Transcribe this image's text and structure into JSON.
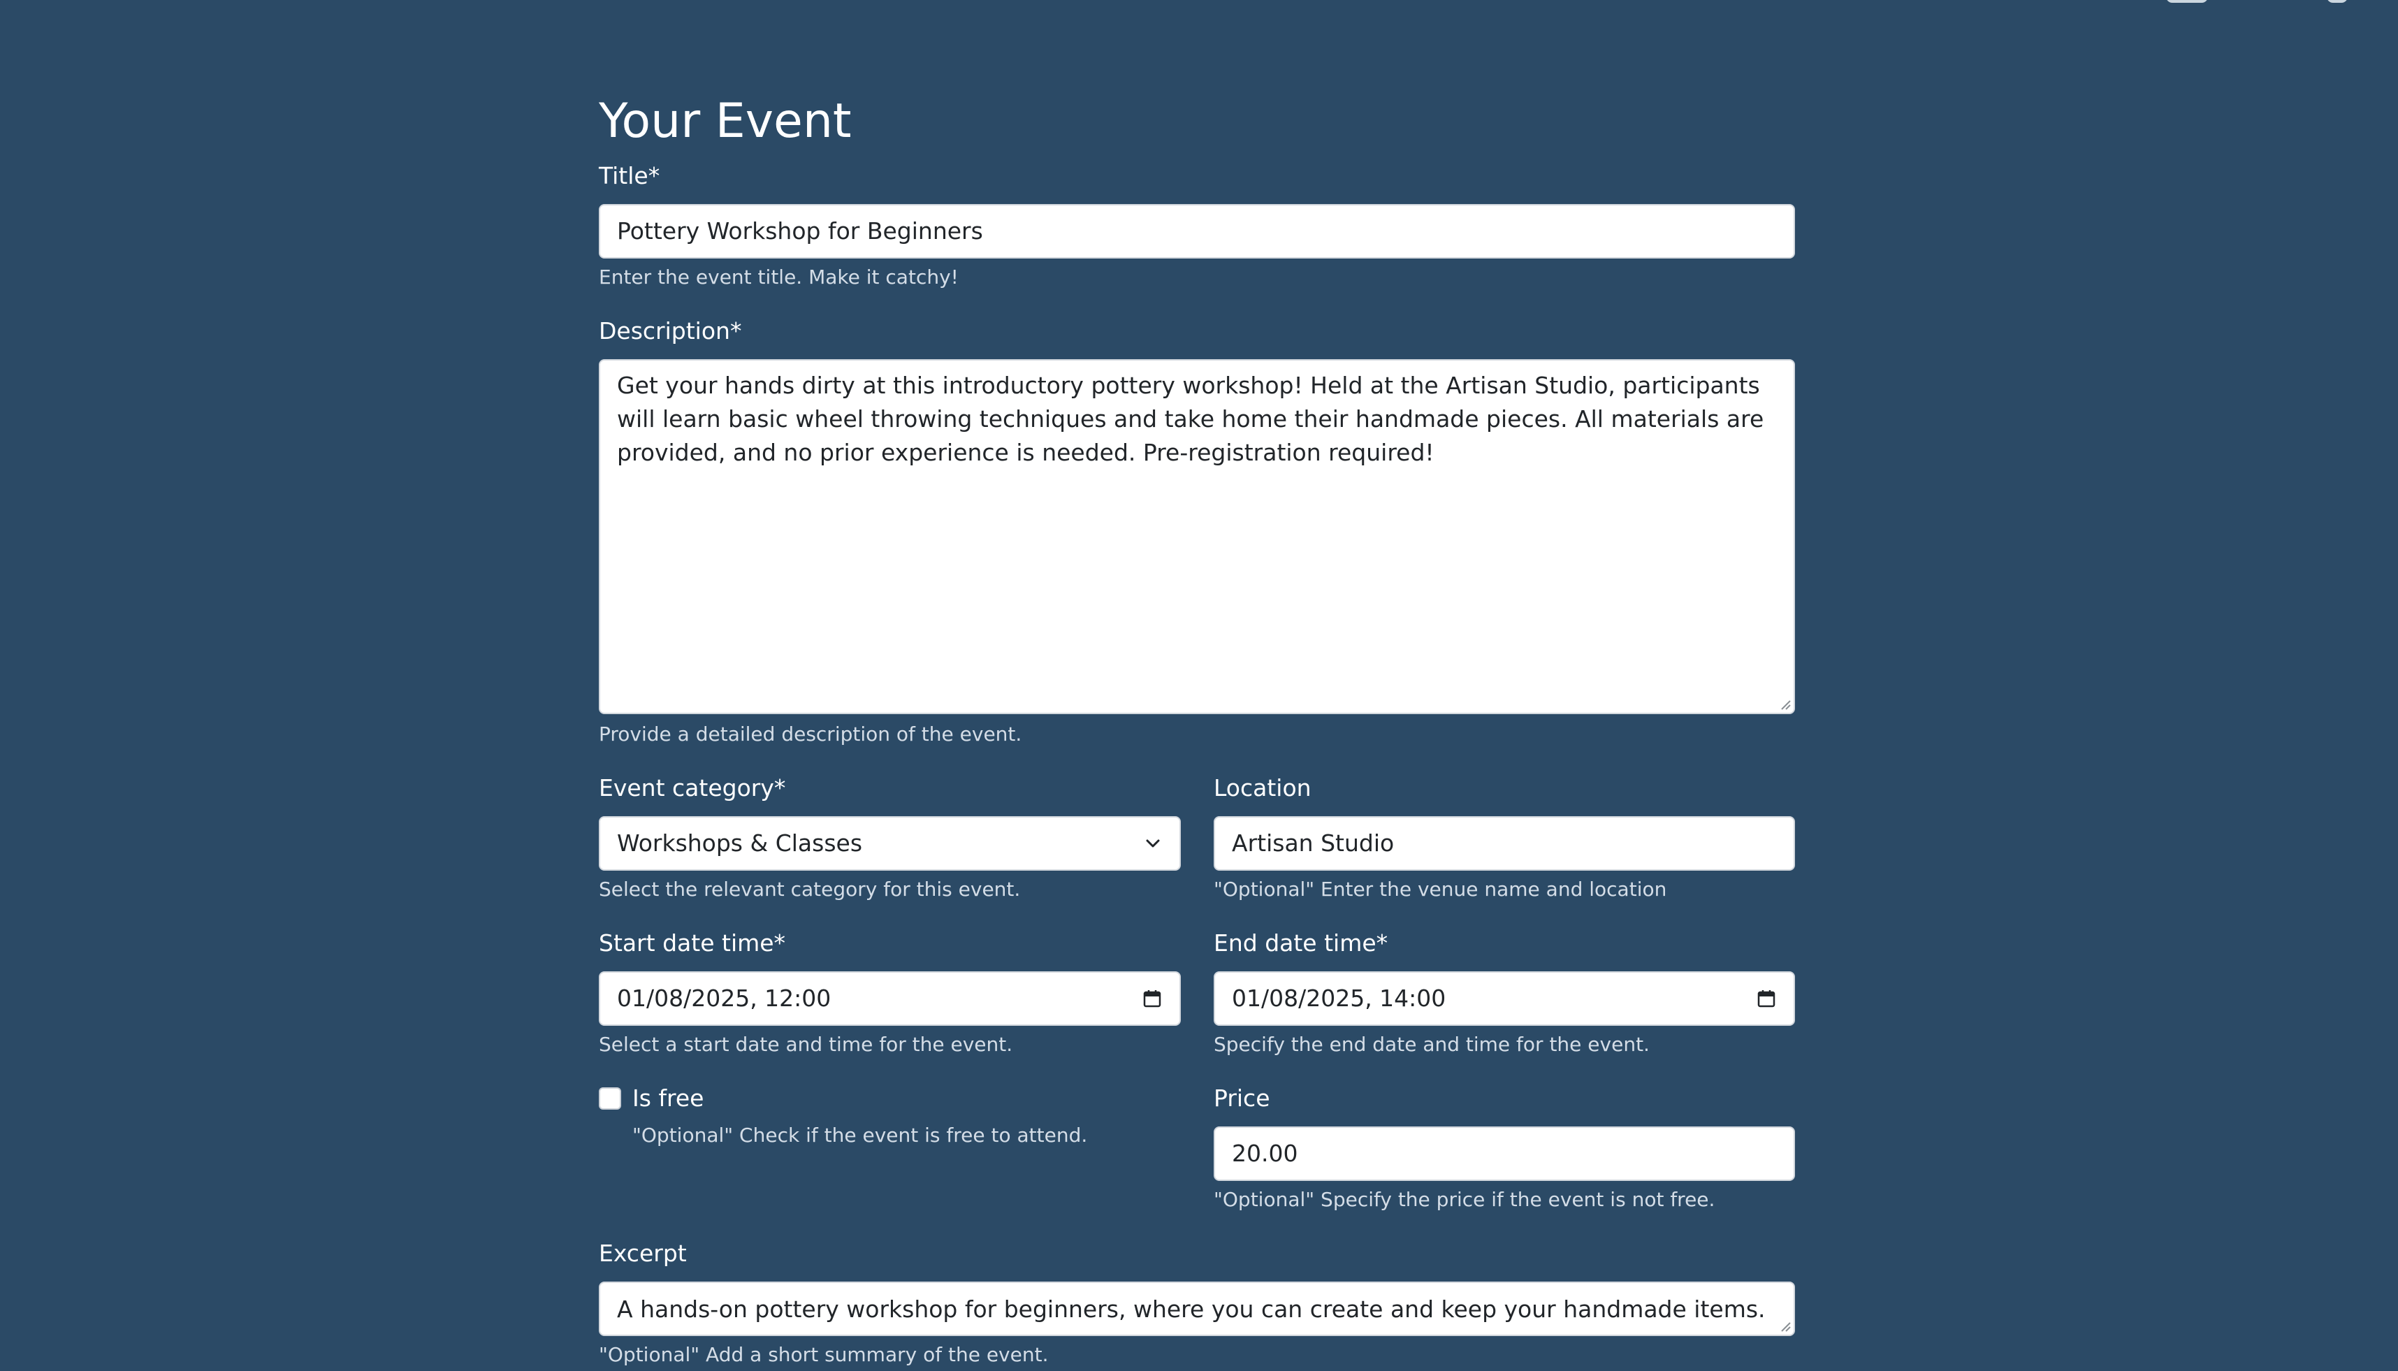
{
  "page": {
    "title": "Your Event"
  },
  "fields": {
    "title": {
      "label": "Title*",
      "value": "Pottery Workshop for Beginners",
      "help": "Enter the event title. Make it catchy!"
    },
    "description": {
      "label": "Description*",
      "value": "Get your hands dirty at this introductory pottery workshop! Held at the Artisan Studio, participants will learn basic wheel throwing techniques and take home their handmade pieces. All materials are provided, and no prior experience is needed. Pre-registration required!",
      "help": "Provide a detailed description of the event."
    },
    "category": {
      "label": "Event category*",
      "value": "Workshops & Classes",
      "help": "Select the relevant category for this event."
    },
    "location": {
      "label": "Location",
      "value": "Artisan Studio",
      "help": "\"Optional\" Enter the venue name and location"
    },
    "start": {
      "label": "Start date time*",
      "value": "01/08/2025, 12:00",
      "help": "Select a start date and time for the event."
    },
    "end": {
      "label": "End date time*",
      "value": "01/08/2025, 14:00",
      "help": "Specify the end date and time for the event."
    },
    "is_free": {
      "label": "Is free",
      "checked": false,
      "help": "\"Optional\" Check if the event is free to attend."
    },
    "price": {
      "label": "Price",
      "value": "20.00",
      "help": "\"Optional\" Specify the price if the event is not free."
    },
    "excerpt": {
      "label": "Excerpt",
      "value": "A hands-on pottery workshop for beginners, where you can create and keep your handmade items.",
      "help": "\"Optional\" Add a short summary of the event."
    }
  },
  "icons": {
    "dropdown": "chevron-down-icon",
    "date_picker": "calendar-icon",
    "resize": "resize-grip-icon"
  },
  "colors": {
    "background": "#2b4a66",
    "input_background": "#ffffff",
    "input_text": "#212529",
    "help_text": "#d4dde7"
  }
}
